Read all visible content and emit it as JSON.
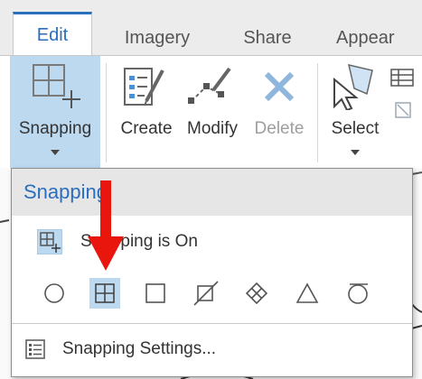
{
  "tabs": [
    {
      "label": "Edit",
      "active": true
    },
    {
      "label": "Imagery",
      "active": false
    },
    {
      "label": "Share",
      "active": false
    },
    {
      "label": "Appear",
      "active": false
    }
  ],
  "ribbon": {
    "snapping_label": "Snapping",
    "create_label": "Create",
    "modify_label": "Modify",
    "delete_label": "Delete",
    "select_label": "Select"
  },
  "dropdown": {
    "title": "Snapping",
    "toggle_label": "Snapping is On",
    "settings_label": "Snapping Settings...",
    "modes": [
      {
        "icon": "point-snap-icon",
        "selected": false
      },
      {
        "icon": "end-snap-icon",
        "selected": true
      },
      {
        "icon": "vertex-snap-icon",
        "selected": false
      },
      {
        "icon": "edge-snap-icon",
        "selected": false
      },
      {
        "icon": "intersection-snap-icon",
        "selected": false
      },
      {
        "icon": "midpoint-snap-icon",
        "selected": false
      },
      {
        "icon": "tangent-snap-icon",
        "selected": false
      }
    ]
  },
  "colors": {
    "accent": "#2a6ebd",
    "pressed": "#bcd9f0",
    "annotation_arrow": "#e8160c"
  }
}
